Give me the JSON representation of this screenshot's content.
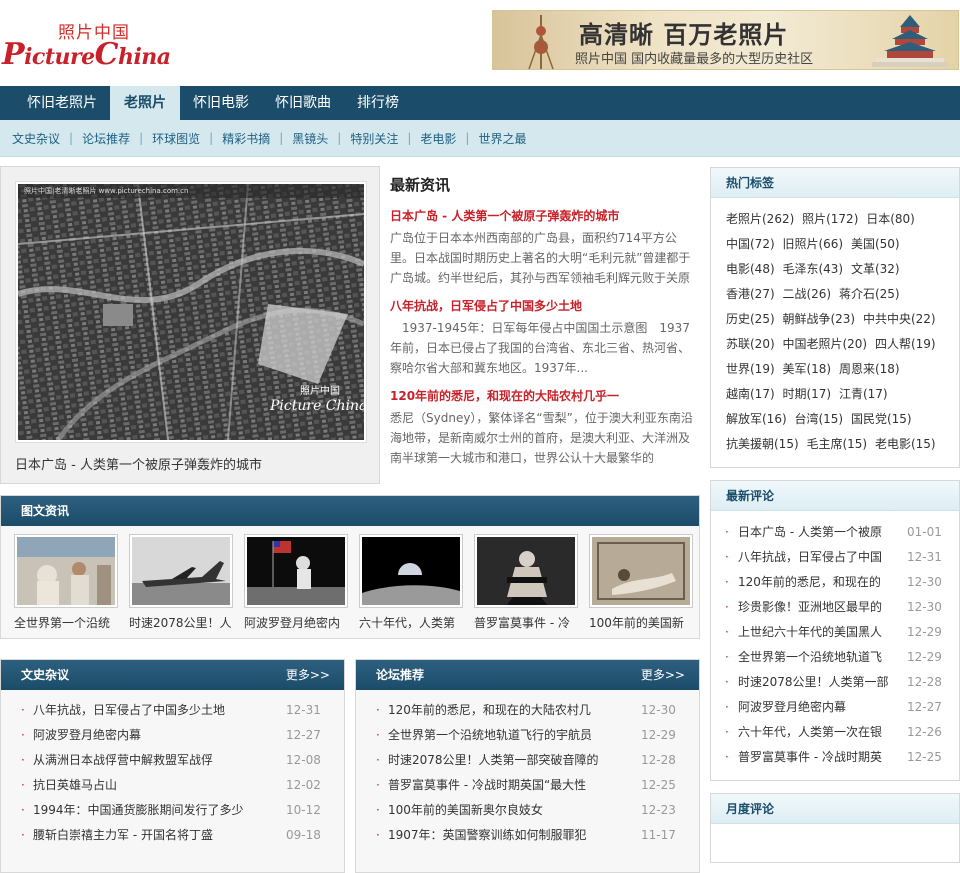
{
  "logo": {
    "cn": "照片中国",
    "en": "PictureChina"
  },
  "banner": {
    "title": "高清晰 百万老照片",
    "subtitle": "照片中国 国内收藏量最多的大型历史社区"
  },
  "nav": [
    "怀旧老照片",
    "老照片",
    "怀旧电影",
    "怀旧歌曲",
    "排行榜"
  ],
  "subnav": [
    "文史杂议",
    "论坛推荐",
    "环球图览",
    "精彩书摘",
    "黑镜头",
    "特别关注",
    "老电影",
    "世界之最"
  ],
  "feature": {
    "caption": "日本广岛 - 人类第一个被原子弹轰炸的城市",
    "watermark_top": "照片中国|老清晰老照片 www.picturechina.com.cn",
    "watermark_cn": "照片中国",
    "watermark_en": "Picture China"
  },
  "news": {
    "heading": "最新资讯",
    "items": [
      {
        "title": "日本广岛 - 人类第一个被原子弹轰炸的城市",
        "desc": "广岛位于日本本州西南部的广岛县，面积约714平方公里。日本战国时期历史上著名的大明“毛利元就”曾建都于广岛城。约半世纪后，其孙与西军领袖毛利辉元败于关原"
      },
      {
        "title": "八年抗战，日军侵占了中国多少土地",
        "desc": "　1937-1945年：日军每年侵占中国国土示意图　1937年前，日本已侵占了我国的台湾省、东北三省、热河省、察哈尔省大部和冀东地区。1937年..."
      },
      {
        "title": "120年前的悉尼，和现在的大陆农村几乎一",
        "desc": "悉尼（Sydney），繁体译名“雪梨”，位于澳大利亚东南沿海地带，是新南威尔士州的首府，是澳大利亚、大洋洲及南半球第一大城市和港口，世界公认十大最繁华的"
      }
    ]
  },
  "pics": {
    "heading": "图文资讯",
    "items": [
      "全世界第一个沿统",
      "时速2078公里！人",
      "阿波罗登月绝密内",
      "六十年代，人类第",
      "普罗富莫事件 - 冷",
      "100年前的美国新"
    ]
  },
  "wenshi": {
    "heading": "文史杂议",
    "more": "更多>>",
    "items": [
      {
        "text": "八年抗战，日军侵占了中国多少土地",
        "date": "12-31"
      },
      {
        "text": "阿波罗登月绝密内幕",
        "date": "12-27"
      },
      {
        "text": "从满洲日本战俘营中解救盟军战俘",
        "date": "12-08"
      },
      {
        "text": "抗日英雄马占山",
        "date": "12-02"
      },
      {
        "text": "1994年：中国通货膨胀期间发行了多少",
        "date": "10-12"
      },
      {
        "text": "腰斩白崇禧主力军 - 开国名将丁盛",
        "date": "09-18"
      }
    ]
  },
  "luntan": {
    "heading": "论坛推荐",
    "more": "更多>>",
    "items": [
      {
        "text": "120年前的悉尼，和现在的大陆农村几",
        "date": "12-30"
      },
      {
        "text": "全世界第一个沿统地轨道飞行的宇航员",
        "date": "12-29"
      },
      {
        "text": "时速2078公里！人类第一部突破音障的",
        "date": "12-28"
      },
      {
        "text": "普罗富莫事件 - 冷战时期英国“最大性",
        "date": "12-25"
      },
      {
        "text": "100年前的美国新奥尔良妓女",
        "date": "12-23"
      },
      {
        "text": "1907年：英国警察训练如何制服罪犯",
        "date": "11-17"
      }
    ]
  },
  "hot_tags": {
    "heading": "热门标签",
    "items": [
      "老照片(262)",
      "照片(172)",
      "日本(80)",
      "中国(72)",
      "旧照片(66)",
      "美国(50)",
      "电影(48)",
      "毛泽东(43)",
      "文革(32)",
      "香港(27)",
      "二战(26)",
      "蒋介石(25)",
      "历史(25)",
      "朝鲜战争(23)",
      "中共中央(22)",
      "苏联(20)",
      "中国老照片(20)",
      "四人帮(19)",
      "世界(19)",
      "美军(18)",
      "周恩来(18)",
      "越南(17)",
      "时期(17)",
      "江青(17)",
      "解放军(16)",
      "台湾(15)",
      "国民党(15)",
      "抗美援朝(15)",
      "毛主席(15)",
      "老电影(15)"
    ]
  },
  "latest_comments": {
    "heading": "最新评论",
    "items": [
      {
        "text": "日本广岛 - 人类第一个被原",
        "date": "01-01"
      },
      {
        "text": "八年抗战，日军侵占了中国",
        "date": "12-31"
      },
      {
        "text": "120年前的悉尼，和现在的",
        "date": "12-30"
      },
      {
        "text": "珍贵影像！亚洲地区最早的",
        "date": "12-30"
      },
      {
        "text": "上世纪六十年代的美国黑人",
        "date": "12-29"
      },
      {
        "text": "全世界第一个沿统地轨道飞",
        "date": "12-29"
      },
      {
        "text": "时速2078公里！人类第一部",
        "date": "12-28"
      },
      {
        "text": "阿波罗登月绝密内幕",
        "date": "12-27"
      },
      {
        "text": "六十年代，人类第一次在银",
        "date": "12-26"
      },
      {
        "text": "普罗富莫事件 - 冷战时期英",
        "date": "12-25"
      }
    ]
  },
  "monthly_comments": {
    "heading": "月度评论"
  },
  "colors": {
    "nav": "#1b4d6a",
    "subnav": "#d4e8ee",
    "accent_red": "#c9212a",
    "date_gray": "#999999"
  }
}
